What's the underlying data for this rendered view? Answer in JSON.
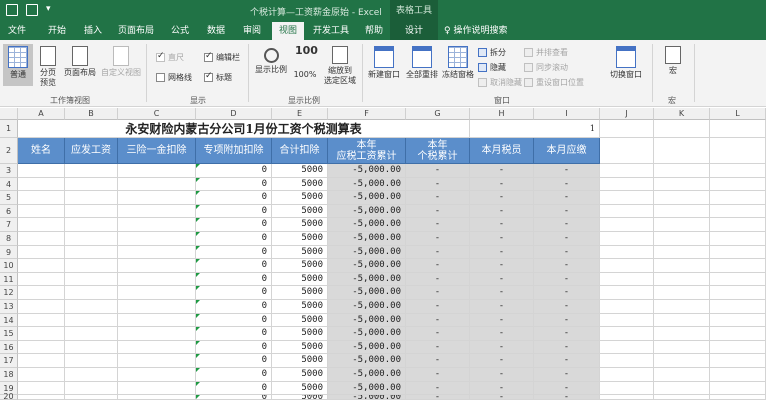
{
  "titlebar": {
    "title": "个税计算—工资薪金原始  -  Excel",
    "context_tab": "表格工具"
  },
  "tabs": [
    "文件",
    "开始",
    "插入",
    "页面布局",
    "公式",
    "数据",
    "审阅",
    "视图",
    "开发工具",
    "帮助",
    "设计"
  ],
  "tell_me": "操作说明搜索",
  "ribbon": {
    "workbook_views": {
      "label": "工作簿视图",
      "normal": "普通",
      "page_break_1": "分页",
      "page_break_2": "预览",
      "page_layout": "页面布局",
      "custom": "自定义视图"
    },
    "show": {
      "label": "显示",
      "ruler": "直尺",
      "formula_bar": "编辑栏",
      "gridlines": "网格线",
      "headings": "标题"
    },
    "zoom": {
      "label": "显示比例",
      "zoom": "显示比例",
      "hundred": "100%",
      "zoom_sel_1": "缩放到",
      "zoom_sel_2": "选定区域"
    },
    "window": {
      "label": "窗口",
      "new_window": "新建窗口",
      "arrange_all": "全部重排",
      "freeze": "冻结窗格",
      "split": "拆分",
      "hide": "隐藏",
      "unhide": "取消隐藏",
      "side_by_side": "并排查看",
      "sync_scroll": "同步滚动",
      "reset_pos": "重设窗口位置",
      "switch": "切换窗口"
    },
    "macros": {
      "label": "宏",
      "macros": "宏"
    }
  },
  "columns": [
    "A",
    "B",
    "C",
    "D",
    "E",
    "F",
    "G",
    "H",
    "I",
    "J",
    "K",
    "L"
  ],
  "sheet": {
    "title": "永安财险内蒙古分公司1月份工资个税测算表",
    "i1_value": "1",
    "headers": {
      "a": "姓名",
      "b": "应发工资",
      "c": "三险一金扣除",
      "d": "专项附加扣除",
      "e": "合计扣除",
      "f1": "本年",
      "f2": "应税工资累计",
      "g1": "本年",
      "g2": "个税累计",
      "h": "本月税员",
      "i": "本月应缴"
    },
    "row_numbers": [
      "1",
      "2",
      "3",
      "4",
      "5",
      "6",
      "7",
      "8",
      "9",
      "10",
      "11",
      "12",
      "13",
      "14",
      "15",
      "16",
      "17",
      "18",
      "19",
      "20"
    ],
    "data_row": {
      "d": "0",
      "e": "5000",
      "f": "-5,000.00",
      "dash": "-"
    }
  }
}
